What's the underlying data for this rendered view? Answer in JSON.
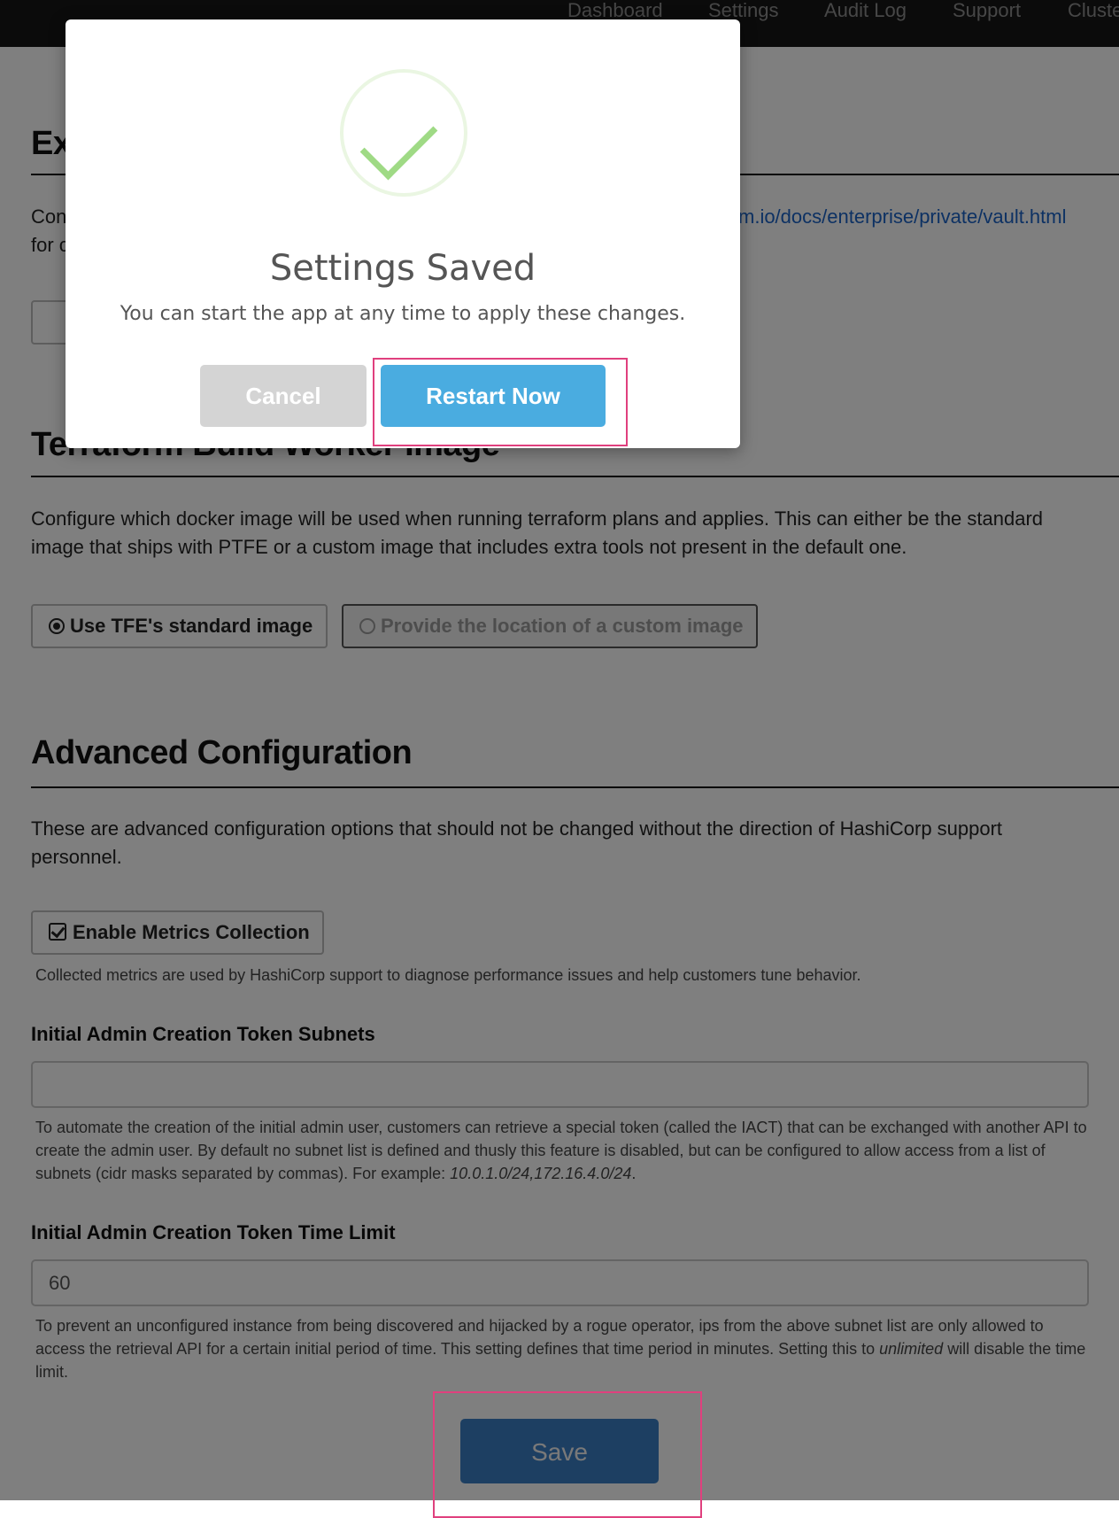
{
  "nav": {
    "items": [
      "Dashboard",
      "Settings",
      "Audit Log",
      "Support",
      "Cluste"
    ]
  },
  "external_vault": {
    "title_visible": "Ex",
    "desc_left_line1": "Con",
    "desc_left_line2": "for c",
    "docs_link_fragment": "m.io/docs/enterprise/private/vault.html"
  },
  "build_worker": {
    "title": "Terraform Build Worker Image",
    "description": "Configure which docker image will be used when running terraform plans and applies. This can either be the standard image that ships with PTFE or a custom image that includes extra tools not present in the default one.",
    "options": [
      {
        "label": "Use TFE's standard image",
        "selected": true
      },
      {
        "label": "Provide the location of a custom image",
        "selected": false
      }
    ]
  },
  "advanced": {
    "title": "Advanced Configuration",
    "description": "These are advanced configuration options that should not be changed without the direction of HashiCorp support personnel.",
    "metrics_label": "Enable Metrics Collection",
    "metrics_checked": true,
    "metrics_help": "Collected metrics are used by HashiCorp support to diagnose performance issues and help customers tune behavior.",
    "subnets_label": "Initial Admin Creation Token Subnets",
    "subnets_value": "",
    "subnets_help_prefix": "To automate the creation of the initial admin user, customers can retrieve a special token (called the IACT) that can be exchanged with another API to create the admin user. By default no subnet list is defined and thusly this feature is disabled, but can be configured to allow access from a list of subnets (cidr masks separated by commas). For example: ",
    "subnets_help_example": "10.0.1.0/24,172.16.4.0/24",
    "subnets_help_suffix": ".",
    "timelimit_label": "Initial Admin Creation Token Time Limit",
    "timelimit_value": "60",
    "timelimit_help_prefix": "To prevent an unconfigured instance from being discovered and hijacked by a rogue operator, ips from the above subnet list are only allowed to access the retrieval API for a certain initial period of time. This setting defines that time period in minutes. Setting this to ",
    "timelimit_help_em": "unlimited",
    "timelimit_help_suffix": " will disable the time limit."
  },
  "save_label": "Save",
  "modal": {
    "title": "Settings Saved",
    "message": "You can start the app at any time to apply these changes.",
    "cancel_label": "Cancel",
    "restart_label": "Restart Now",
    "icon": "checkmark-icon"
  },
  "colors": {
    "primary": "#4aace0",
    "save": "#3b7fc4",
    "success": "#9fda85",
    "highlight": "#e0407e",
    "nav_bg": "#161616"
  }
}
